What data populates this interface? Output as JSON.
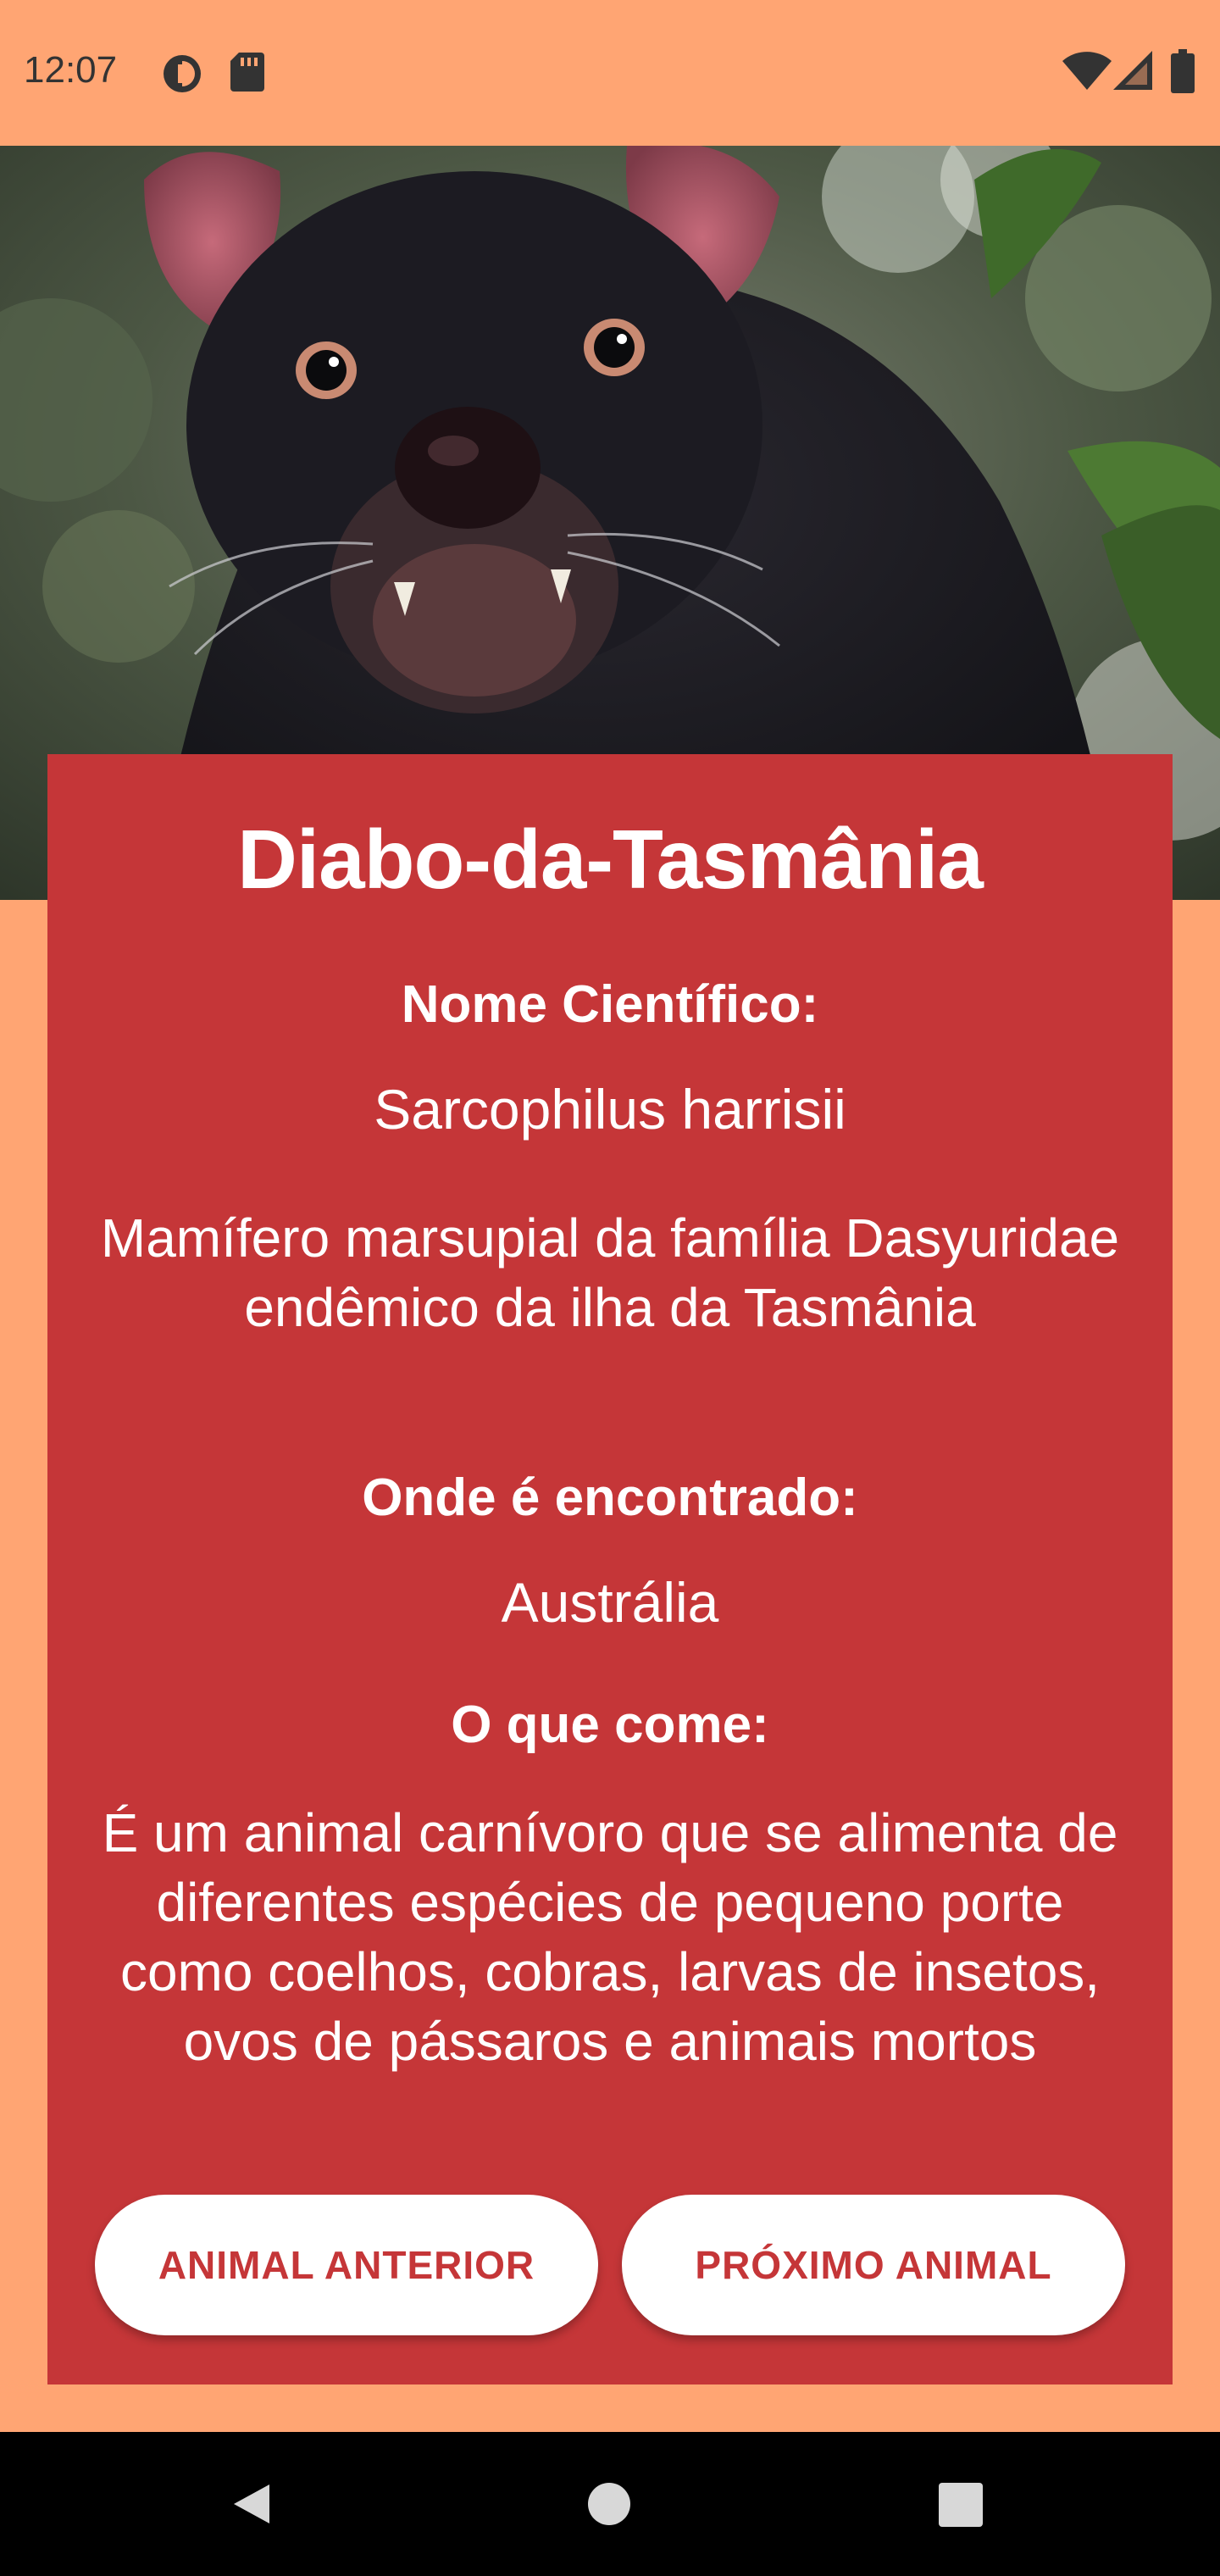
{
  "status_bar": {
    "time": "12:07",
    "icons_left": [
      "data-saver-icon",
      "sd-card-icon"
    ],
    "icons_right": [
      "wifi-icon",
      "cell-signal-icon",
      "battery-icon"
    ]
  },
  "hero": {
    "image": "tasmanian-devil-photo"
  },
  "animal": {
    "name": "Diabo-da-Tasmânia",
    "scientific_label": "Nome Científico:",
    "scientific_name": "Sarcophilus harrisii",
    "description": "Mamífero marsupial da família Dasyuridae endêmico da ilha da Tasmânia",
    "location_label": "Onde é encontrado:",
    "location": "Austrália",
    "diet_label": "O que come:",
    "diet": "É um animal carnívoro que se alimenta de diferentes espécies de pequeno porte como coelhos, cobras, larvas de insetos, ovos de pássaros e animais mortos"
  },
  "buttons": {
    "previous": "ANIMAL ANTERIOR",
    "next": "PRÓXIMO ANIMAL"
  },
  "nav": {
    "back": "back-icon",
    "home": "home-icon",
    "recents": "recents-icon"
  },
  "colors": {
    "background": "#FFA573",
    "card": "#C53638",
    "button": "#FFFFFF",
    "button_text": "#C53638"
  }
}
